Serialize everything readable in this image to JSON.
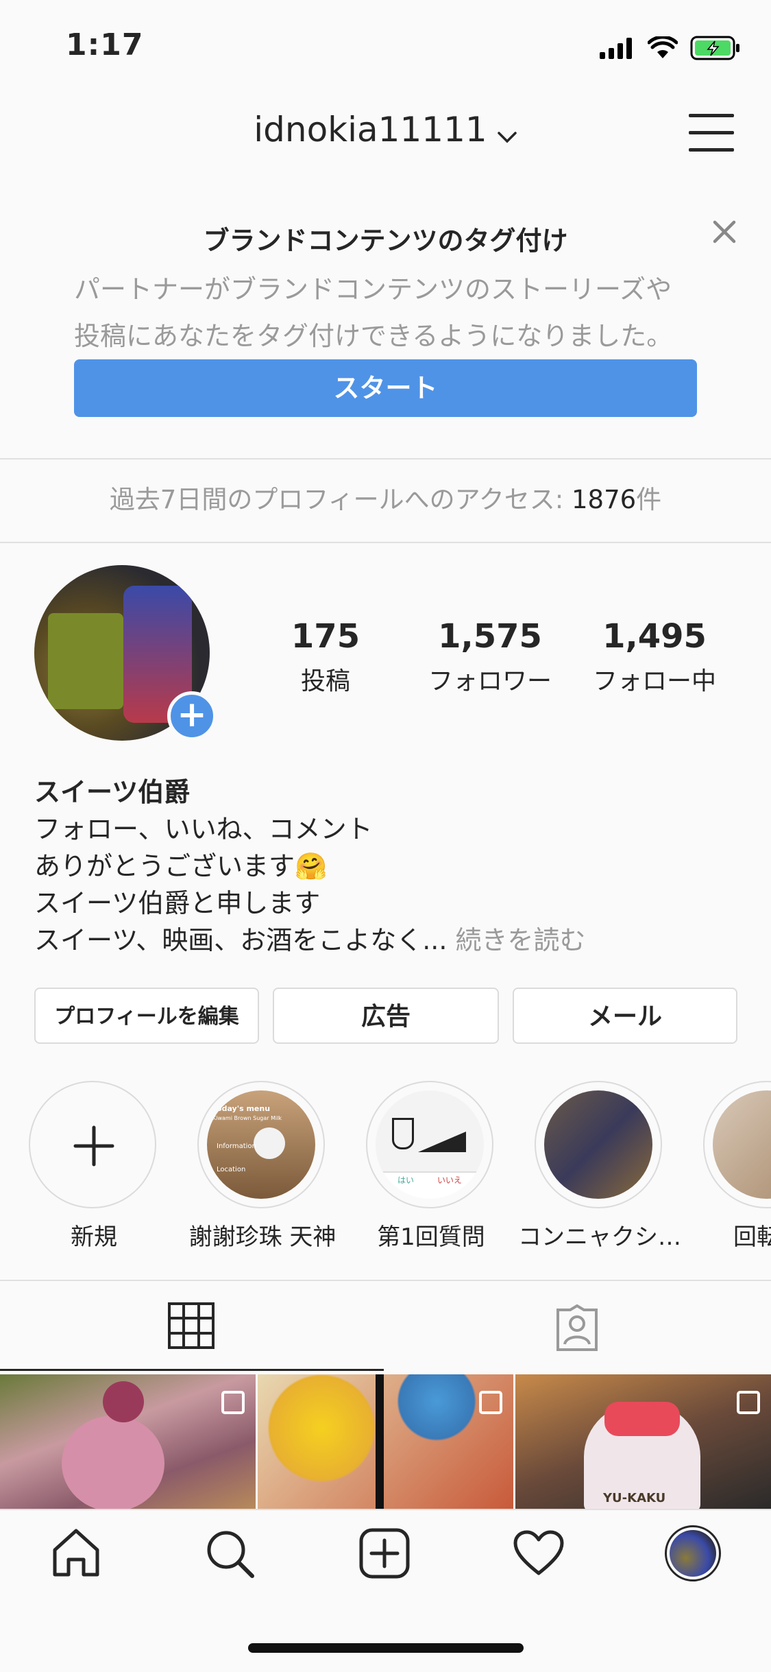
{
  "status_bar": {
    "time": "1:17"
  },
  "header": {
    "username": "idnokia11111"
  },
  "banner": {
    "title": "ブランドコンテンツのタグ付け",
    "description_line1": "パートナーがブランドコンテンツのストーリーズや",
    "description_line2": "投稿にあなたをタグ付けできるようになりました。",
    "button_label": "スタート"
  },
  "access": {
    "label": "過去7日間のプロフィールへのアクセス: ",
    "count": "1876",
    "unit": "件"
  },
  "stats": {
    "posts_count": "175",
    "posts_label": "投稿",
    "followers_count": "1,575",
    "followers_label": "フォロワー",
    "following_count": "1,495",
    "following_label": "フォロー中"
  },
  "bio": {
    "name": "スイーツ伯爵",
    "line1": "フォロー、いいね、コメント",
    "line2": "ありがとうございます🤗",
    "line3": "スイーツ伯爵と申します",
    "line4": "スイーツ、映画、お酒をこよなく...",
    "read_more": "続きを読む"
  },
  "buttons": {
    "edit_profile": "プロフィールを編集",
    "ads": "広告",
    "email": "メール"
  },
  "highlights": [
    {
      "label": "新規"
    },
    {
      "label": "謝謝珍珠 天神"
    },
    {
      "label": "第1回質問"
    },
    {
      "label": "コンニャクシ…"
    },
    {
      "label": "回転ス"
    }
  ],
  "highlight_thumb_text": {
    "menu": "Today's menu",
    "sub": "Kiwami Brown Sugar Milk",
    "info": "Information",
    "location": "Location",
    "yes": "はい",
    "no": "いいえ"
  },
  "grid": {
    "cup_brand": "YU-KAKU"
  },
  "icons": {
    "grid_tab": "grid-icon",
    "tagged_tab": "tagged-person-icon",
    "nav": [
      "home-icon",
      "search-icon",
      "add-post-icon",
      "heart-icon",
      "profile-avatar"
    ]
  },
  "colors": {
    "accent": "#4f93e7",
    "text": "#262626",
    "muted": "#9a9a9a",
    "battery": "#4cd964"
  }
}
